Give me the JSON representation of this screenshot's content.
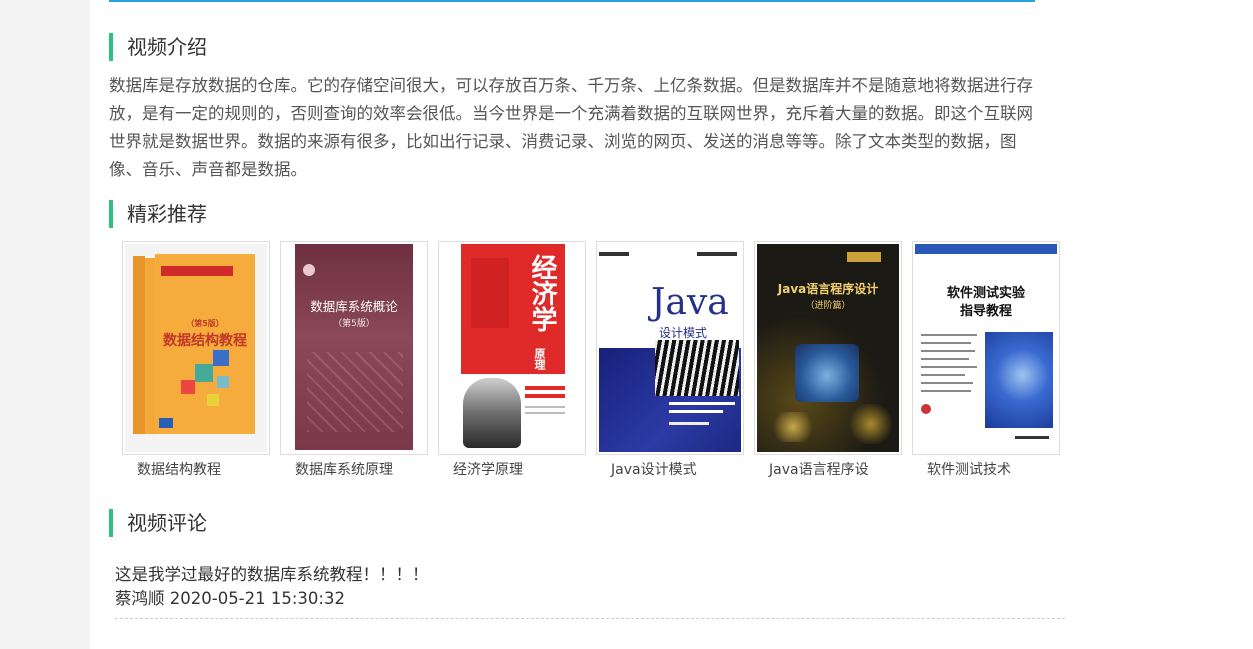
{
  "sections": {
    "intro_title": "视频介绍",
    "recommend_title": "精彩推荐",
    "comments_title": "视频评论"
  },
  "intro": {
    "text": "数据库是存放数据的仓库。它的存储空间很大，可以存放百万条、千万条、上亿条数据。但是数据库并不是随意地将数据进行存放，是有一定的规则的，否则查询的效率会很低。当今世界是一个充满着数据的互联网世界，充斥着大量的数据。即这个互联网世界就是数据世界。数据的来源有很多，比如出行记录、消费记录、浏览的网页、发送的消息等等。除了文本类型的数据，图像、音乐、声音都是数据。"
  },
  "books": [
    {
      "title": "数据结构教程",
      "cover_text": "数据结构教程",
      "cover_sub": "（第5版）",
      "accent": "#f0a030"
    },
    {
      "title": "数据库系统原理",
      "cover_text": "数据库系统概论",
      "cover_sub": "（第5版）",
      "accent": "#7a3848"
    },
    {
      "title": "经济学原理",
      "cover_text": "经济学",
      "cover_sub": "原理",
      "accent": "#e02a2a"
    },
    {
      "title": "Java设计模式",
      "cover_text": "Java",
      "cover_sub": "设计模式",
      "accent": "#24308a"
    },
    {
      "title": "Java语言程序设",
      "cover_text": "Java语言程序设计",
      "cover_sub": "（进阶篇）",
      "accent": "#1c1a14"
    },
    {
      "title": "软件测试技术",
      "cover_text": "软件测试实验",
      "cover_sub": "指导教程",
      "accent": "#2a58b8"
    }
  ],
  "comments": [
    {
      "text": "这是我学过最好的数据库系统教程！！！！",
      "author_line": "蔡鸿顺 2020-05-21 15:30:32"
    }
  ]
}
